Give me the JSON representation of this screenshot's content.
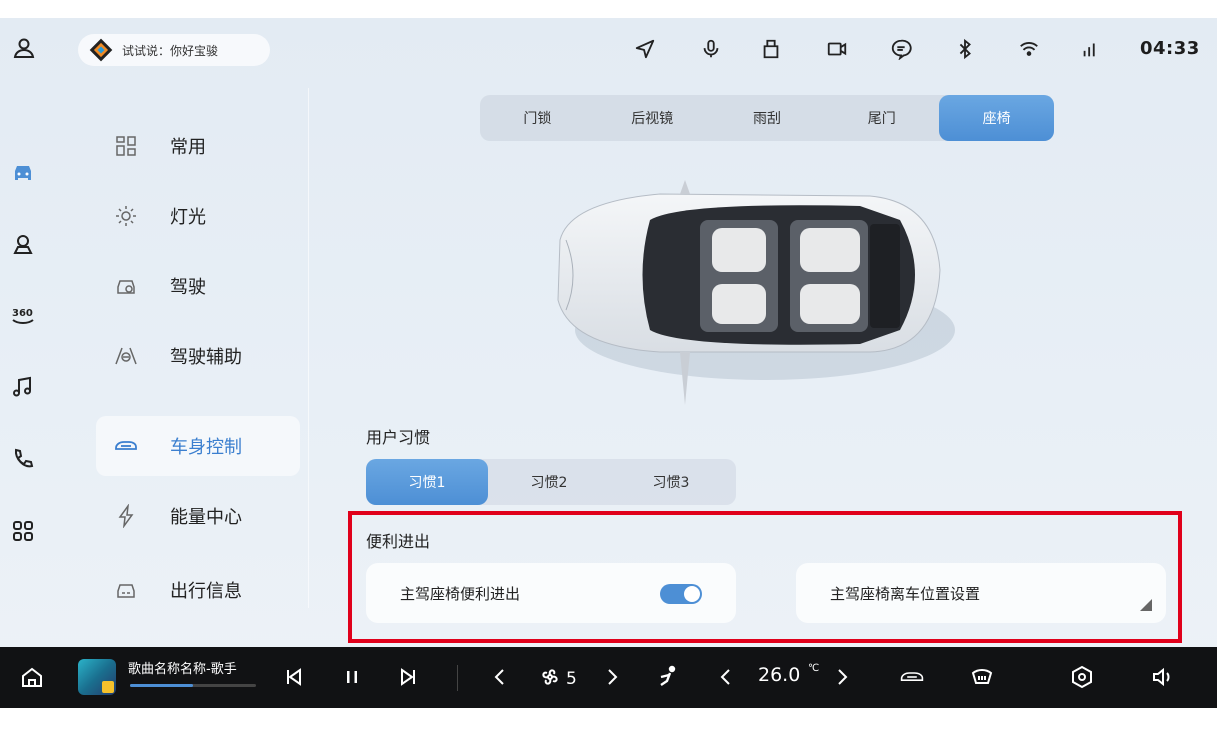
{
  "status_bar": {
    "voice_prompt": "试试说：你好宝骏",
    "time": "04:33"
  },
  "sidebar": {
    "items": [
      {
        "label": "常用",
        "icon": "grid-icon"
      },
      {
        "label": "灯光",
        "icon": "bulb-icon"
      },
      {
        "label": "驾驶",
        "icon": "car-front-icon"
      },
      {
        "label": "驾驶辅助",
        "icon": "assist-icon"
      },
      {
        "label": "车身控制",
        "icon": "car-body-icon",
        "active": true
      },
      {
        "label": "能量中心",
        "icon": "lightning-icon"
      },
      {
        "label": "出行信息",
        "icon": "trip-icon"
      }
    ]
  },
  "tabs": [
    {
      "label": "门锁"
    },
    {
      "label": "后视镜"
    },
    {
      "label": "雨刮"
    },
    {
      "label": "尾门"
    },
    {
      "label": "座椅",
      "active": true
    }
  ],
  "habits": {
    "title": "用户习惯",
    "options": [
      {
        "label": "习惯1",
        "active": true
      },
      {
        "label": "习惯2"
      },
      {
        "label": "习惯3"
      }
    ]
  },
  "convenient_entry": {
    "title": "便利进出",
    "seat_entry_label": "主驾座椅便利进出",
    "seat_entry_on": true,
    "exit_position_label": "主驾座椅离车位置设置"
  },
  "bottom_bar": {
    "song": "歌曲名称名称-歌手",
    "progress": 0.5,
    "fan_level": "5",
    "temperature": "26.0",
    "temp_unit": "℃"
  },
  "colors": {
    "accent": "#4d8fd5",
    "highlight": "#e0001b"
  }
}
